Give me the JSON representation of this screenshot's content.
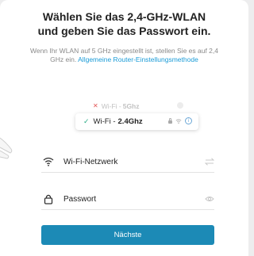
{
  "title": "Wählen Sie das 2,4-GHz-WLAN\nund geben Sie das Passwort ein.",
  "description": {
    "text": "Wenn Ihr WLAN auf 5 GHz eingestellt ist, stellen Sie es auf 2,4 GHz ein. ",
    "link": "Allgemeine Router-Einstellungsmethode"
  },
  "bands": {
    "five": {
      "mark": "✕",
      "prefix": "Wi-Fi -",
      "name": "5Ghz"
    },
    "two": {
      "mark": "✓",
      "prefix": "Wi-Fi -",
      "name": "2.4Ghz"
    }
  },
  "fields": {
    "wifi": {
      "label": "Wi-Fi-Netzwerk",
      "icon": "wifi-icon",
      "action_icon": "swap-icon"
    },
    "password": {
      "label": "Passwort",
      "icon": "lock-icon",
      "action_icon": "eye-icon"
    }
  },
  "next_button": "Nächste",
  "colors": {
    "accent": "#1c8ab6",
    "link": "#1a9bd7",
    "check": "#2bab86",
    "cross": "#e25555"
  }
}
